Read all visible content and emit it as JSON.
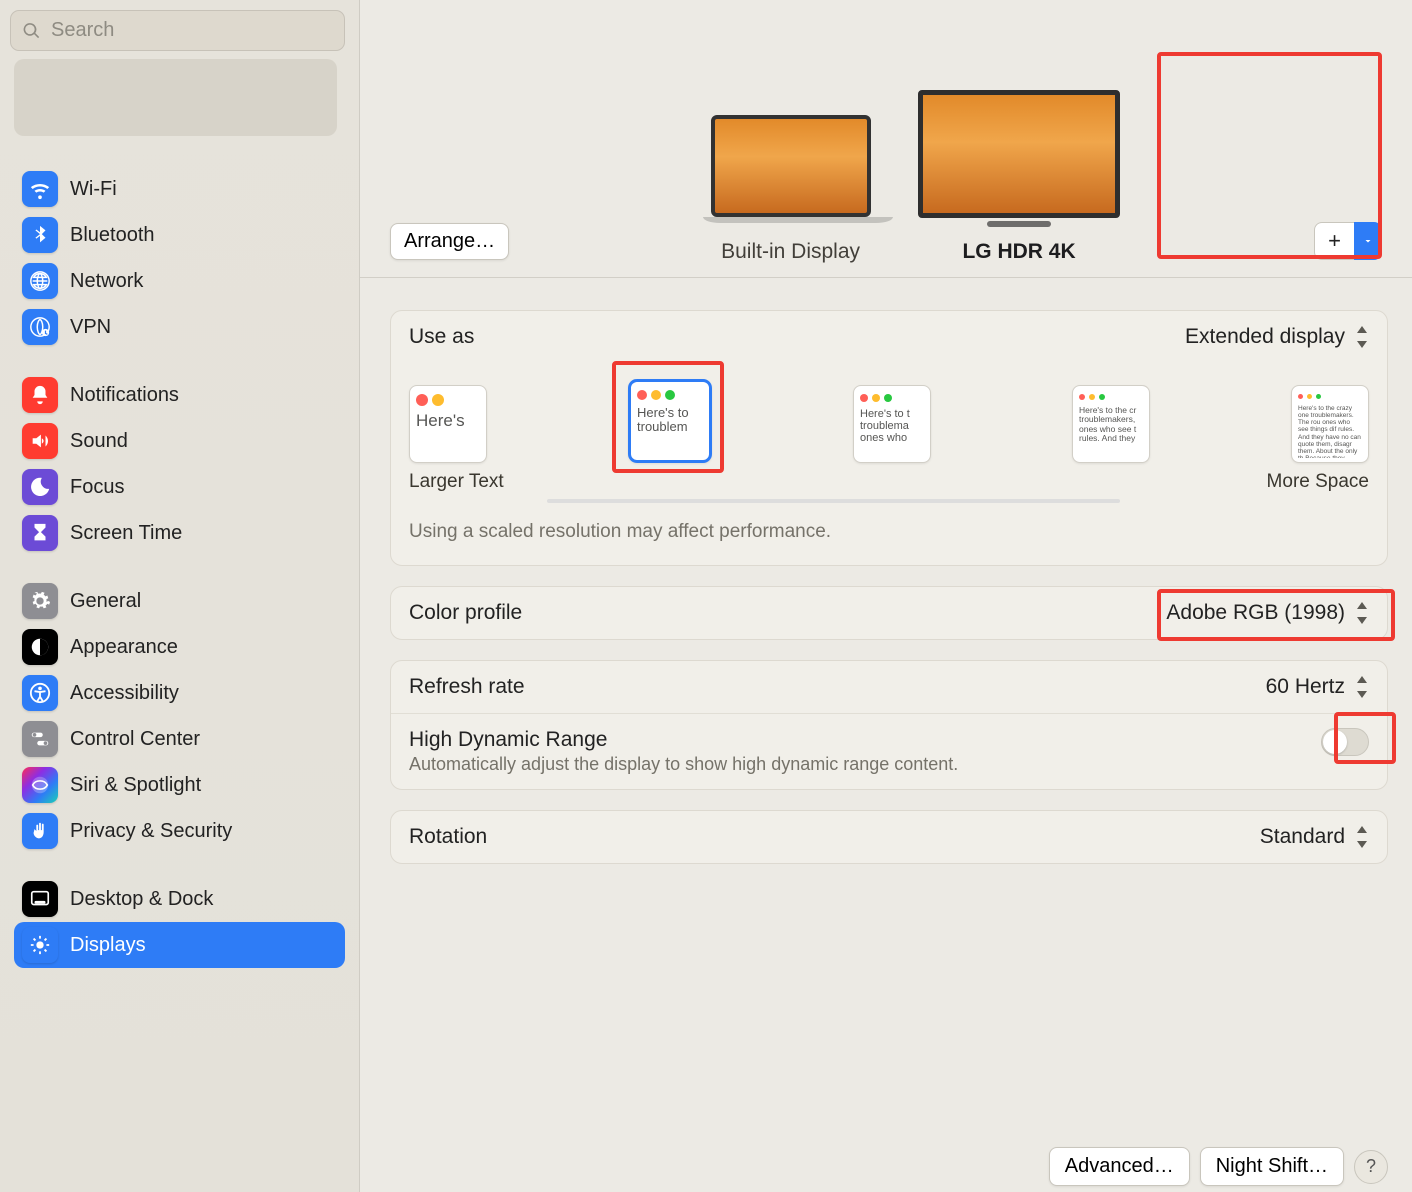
{
  "search": {
    "placeholder": "Search"
  },
  "sidebar": {
    "group1": [
      {
        "label": "Wi-Fi",
        "color": "ic-blue",
        "icon": "wifi-icon"
      },
      {
        "label": "Bluetooth",
        "color": "ic-blue",
        "icon": "bluetooth-icon"
      },
      {
        "label": "Network",
        "color": "ic-blue",
        "icon": "globe-icon"
      },
      {
        "label": "VPN",
        "color": "ic-blue",
        "icon": "globe-badge-icon"
      }
    ],
    "group2": [
      {
        "label": "Notifications",
        "color": "ic-red",
        "icon": "bell-icon"
      },
      {
        "label": "Sound",
        "color": "ic-red",
        "icon": "speaker-icon"
      },
      {
        "label": "Focus",
        "color": "ic-purple",
        "icon": "moon-icon"
      },
      {
        "label": "Screen Time",
        "color": "ic-purple",
        "icon": "hourglass-icon"
      }
    ],
    "group3": [
      {
        "label": "General",
        "color": "ic-gray",
        "icon": "gear-icon"
      },
      {
        "label": "Appearance",
        "color": "ic-black",
        "icon": "appearance-icon"
      },
      {
        "label": "Accessibility",
        "color": "ic-blue",
        "icon": "accessibility-icon"
      },
      {
        "label": "Control Center",
        "color": "ic-gray",
        "icon": "switches-icon"
      },
      {
        "label": "Siri & Spotlight",
        "color": "ic-multi",
        "icon": "siri-icon"
      },
      {
        "label": "Privacy & Security",
        "color": "ic-blue",
        "icon": "hand-icon"
      }
    ],
    "group4": [
      {
        "label": "Desktop & Dock",
        "color": "ic-black",
        "icon": "dock-icon"
      },
      {
        "label": "Displays",
        "color": "ic-blue",
        "icon": "sun-icon",
        "selected": true
      }
    ]
  },
  "monitors": {
    "arrange_label": "Arrange…",
    "builtin_label": "Built-in Display",
    "external_label": "LG HDR 4K",
    "add_plus": "+"
  },
  "settings": {
    "use_as_label": "Use as",
    "use_as_value": "Extended display",
    "res": {
      "larger_text": "Larger Text",
      "more_space": "More Space",
      "tile_text_large": "Here's",
      "tile_text_sel": "Here's to troublem",
      "tile_text_3": "Here's to t troublema ones who",
      "tile_text_4": "Here's to the cr troublemakers, ones who see t rules. And they",
      "tile_text_5": "Here's to the crazy one troublemakers. The rou ones who see things dif rules. And they have no can quote them, disagr them. About the only th Because they change t",
      "note": "Using a scaled resolution may affect performance."
    },
    "color_label": "Color profile",
    "color_value": "Adobe RGB (1998)",
    "refresh_label": "Refresh rate",
    "refresh_value": "60 Hertz",
    "hdr_label": "High Dynamic Range",
    "hdr_sub": "Automatically adjust the display to show high dynamic range content.",
    "hdr_on": false,
    "rotation_label": "Rotation",
    "rotation_value": "Standard"
  },
  "footer": {
    "advanced": "Advanced…",
    "nightshift": "Night Shift…",
    "help": "?"
  }
}
